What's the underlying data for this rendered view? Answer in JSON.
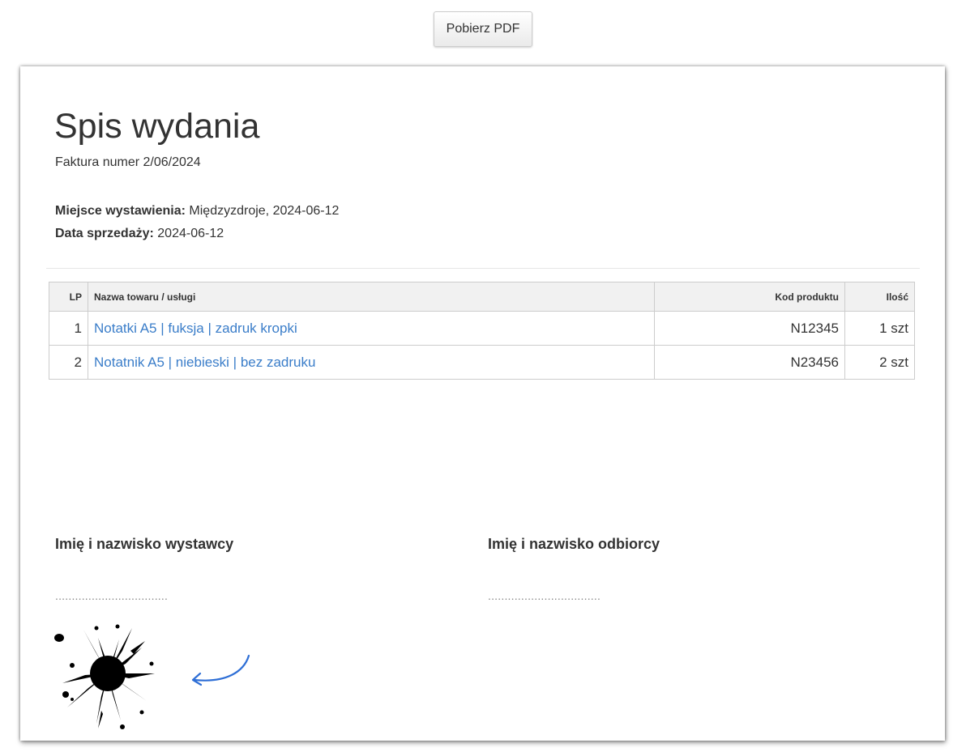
{
  "toolbar": {
    "download_pdf_label": "Pobierz PDF"
  },
  "document": {
    "title": "Spis wydania",
    "invoice_number": "Faktura numer 2/06/2024",
    "place_label": "Miejsce wystawienia:",
    "place_value": " Międzyzdroje, 2024-06-12",
    "sale_date_label": "Data sprzedaży:",
    "sale_date_value": " 2024-06-12"
  },
  "table": {
    "headers": {
      "lp": "LP",
      "name": "Nazwa towaru / usługi",
      "code": "Kod produktu",
      "qty": "Ilość"
    },
    "rows": [
      {
        "lp": "1",
        "name": "Notatki A5 | fuksja | zadruk kropki",
        "code": "N12345",
        "qty": "1 szt"
      },
      {
        "lp": "2",
        "name": "Notatnik A5 | niebieski | bez zadruku",
        "code": "N23456",
        "qty": "2 szt"
      }
    ]
  },
  "signatures": {
    "issuer_label": "Imię i nazwisko wystawcy",
    "receiver_label": "Imię i nazwisko odbiorcy",
    "issuer_line": "..................................",
    "receiver_line": ".................................."
  },
  "decorations": {
    "signature_mark_icon": "ink-splat-icon",
    "pointer_icon": "curved-arrow-icon",
    "link_color": "#3a7dc9",
    "arrow_color": "#2f6fd6"
  }
}
